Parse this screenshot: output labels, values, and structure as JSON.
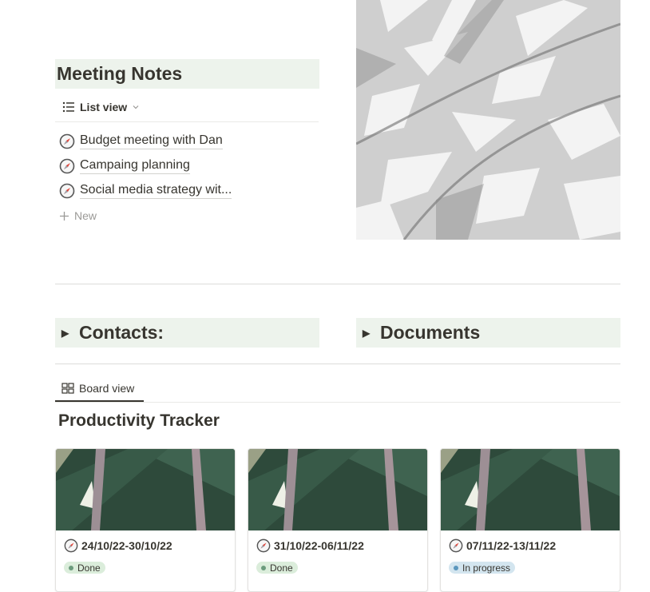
{
  "meeting_notes": {
    "heading": "Meeting Notes",
    "view_label": "List view",
    "items": [
      {
        "title": "Budget meeting with Dan",
        "icon": "compass-icon"
      },
      {
        "title": "Campaing planning",
        "icon": "compass-icon"
      },
      {
        "title": "Social media strategy wit...",
        "icon": "compass-icon"
      }
    ],
    "new_label": "New"
  },
  "toggles": {
    "contacts": "Contacts:",
    "documents": "Documents"
  },
  "board": {
    "view_label": "Board view",
    "title": "Productivity Tracker",
    "cards": [
      {
        "title": "24/10/22-30/10/22",
        "status": "Done"
      },
      {
        "title": "31/10/22-06/11/22",
        "status": "Done"
      },
      {
        "title": "07/11/22-13/11/22",
        "status": "In progress"
      }
    ]
  },
  "colors": {
    "heading_bg": "#edf3ec",
    "done_tag_bg": "#dbeddb",
    "done_dot": "#6c9b7d",
    "in_progress_tag_bg": "#d3e5ef",
    "in_progress_dot": "#5b97bd",
    "text": "#37352f"
  }
}
